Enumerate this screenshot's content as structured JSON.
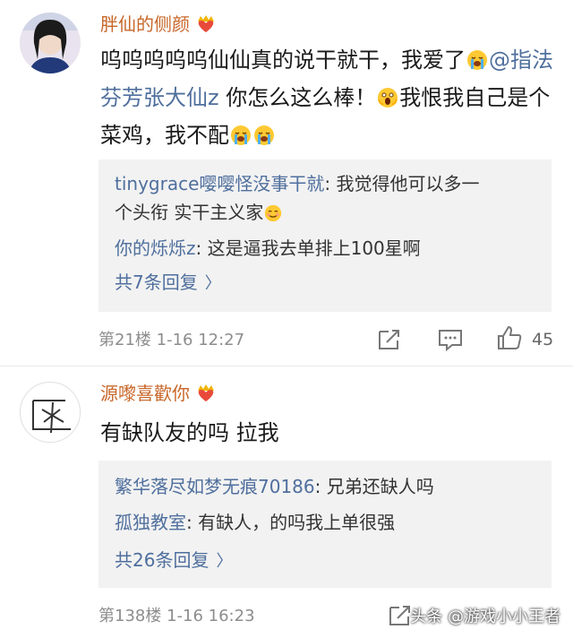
{
  "comments": [
    {
      "username": "胖仙的侧颜",
      "badge_icon": "crown-heart-badge-icon",
      "text_part1": "呜呜呜呜呜仙仙真的说干就干，我爱了",
      "mention": "@指法芬芳张大仙z",
      "text_part2": " 你怎么这么棒！",
      "text_part3": "我恨我自己是个菜鸡，我不配",
      "replies": [
        {
          "user": "tinygrace嘤嘤怪没事干就",
          "text_line1": ": 我觉得他可以多一",
          "text_line2": "个头衔 实干主义家"
        },
        {
          "user": "你的烁烁z",
          "text_line1": ": 这是逼我去单排上100星啊"
        }
      ],
      "more_replies": "共7条回复",
      "floor_time": "第21楼 1-16 12:27",
      "like_count": "45"
    },
    {
      "username": "源嚟喜歡你",
      "badge_icon": "crown-heart-badge-icon",
      "text": "有缺队友的吗 拉我",
      "replies": [
        {
          "user": "繁华落尽如梦无痕70186",
          "text_line1": ": 兄弟还缺人吗"
        },
        {
          "user": "孤独教室",
          "text_line1": ": 有缺人，的吗我上单很强"
        }
      ],
      "more_replies": "共26条回复",
      "floor_time": "第138楼 1-16 16:23"
    }
  ],
  "watermark": "头条 @游戏小小王者",
  "colors": {
    "username": "#c8672a",
    "link": "#4f6f9d",
    "reply_bg": "#f2f2f2",
    "meta": "#8d8d8d"
  }
}
